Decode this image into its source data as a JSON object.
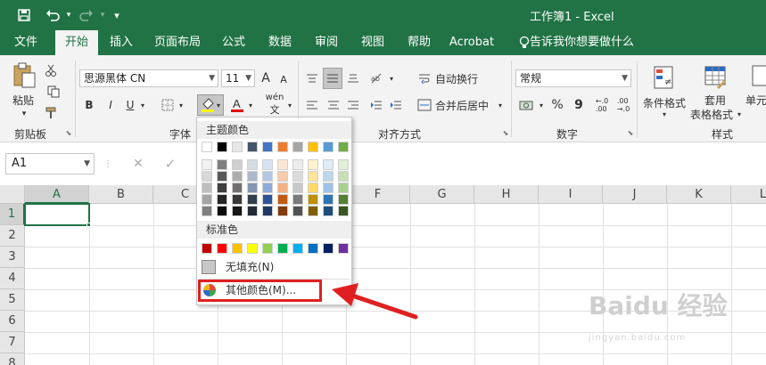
{
  "window": {
    "title": "工作簿1  -  Excel"
  },
  "quick_access": {
    "save": "save-icon",
    "undo": "undo-icon",
    "redo": "redo-icon",
    "customize": "▾"
  },
  "tabs": [
    "文件",
    "开始",
    "插入",
    "页面布局",
    "公式",
    "数据",
    "审阅",
    "视图",
    "帮助",
    "Acrobat",
    "告诉我你想要做什么"
  ],
  "ribbon": {
    "clipboard": {
      "paste": "粘贴",
      "label": "剪贴板"
    },
    "font": {
      "name": "思源黑体 CN",
      "size": "11",
      "label": "字体",
      "bold": "B",
      "italic": "I",
      "underline": "U",
      "grow": "A",
      "shrink": "A",
      "wen": "wén"
    },
    "alignment": {
      "wrap": "自动换行",
      "merge": "合并后居中",
      "label": "对齐方式"
    },
    "number": {
      "format": "常规",
      "percent": "%",
      "comma": "9",
      "label": "数字"
    },
    "styles": {
      "conditional": "条件格式",
      "table_line1": "套用",
      "table_line2": "表格格式",
      "cell": "单元",
      "label": "样式"
    }
  },
  "formula_bar": {
    "name_box": "A1",
    "cancel": "✕",
    "enter": "✓",
    "fx": "fx"
  },
  "sheet": {
    "columns": [
      "A",
      "B",
      "C",
      "D",
      "E",
      "F",
      "G",
      "H",
      "I",
      "J",
      "K",
      "L"
    ],
    "rows": [
      "1",
      "2",
      "3",
      "4",
      "5",
      "6",
      "7",
      "8"
    ],
    "selected_cell": "A1"
  },
  "fill_dropdown": {
    "theme_header": "主题颜色",
    "standard_header": "标准色",
    "no_fill": "无填充(N)",
    "more_colors": "其他颜色(M)...",
    "theme_top": [
      "#ffffff",
      "#000000",
      "#e7e6e6",
      "#44546a",
      "#4472c4",
      "#ed7d31",
      "#a5a5a5",
      "#ffc000",
      "#5b9bd5",
      "#70ad47"
    ],
    "theme_shades": [
      [
        "#f2f2f2",
        "#7f7f7f",
        "#d0cece",
        "#d6dce4",
        "#d9e2f3",
        "#fbe5d5",
        "#ededed",
        "#fff2cc",
        "#deebf6",
        "#e2efd9"
      ],
      [
        "#d8d8d8",
        "#595959",
        "#aeabab",
        "#adb9ca",
        "#b4c6e7",
        "#f7cbac",
        "#dbdbdb",
        "#fee599",
        "#bdd7ee",
        "#c5e0b3"
      ],
      [
        "#bfbfbf",
        "#3f3f3f",
        "#757070",
        "#8496b0",
        "#8eaadb",
        "#f4b183",
        "#c9c9c9",
        "#ffd965",
        "#9cc3e5",
        "#a8d08d"
      ],
      [
        "#a5a5a5",
        "#262626",
        "#3a3838",
        "#323f4f",
        "#2f5496",
        "#c55a11",
        "#7b7b7b",
        "#bf9000",
        "#2e75b5",
        "#538135"
      ],
      [
        "#7f7f7f",
        "#0c0c0c",
        "#171616",
        "#222a35",
        "#1f3864",
        "#833c0b",
        "#525252",
        "#7f6000",
        "#1e4e79",
        "#375623"
      ]
    ],
    "standard": [
      "#c00000",
      "#ff0000",
      "#ffc000",
      "#ffff00",
      "#92d050",
      "#00b050",
      "#00b0f0",
      "#0070c0",
      "#002060",
      "#7030a0"
    ]
  },
  "watermark": {
    "brand": "Baidu 经验",
    "url": "jingyan.baidu.com"
  }
}
